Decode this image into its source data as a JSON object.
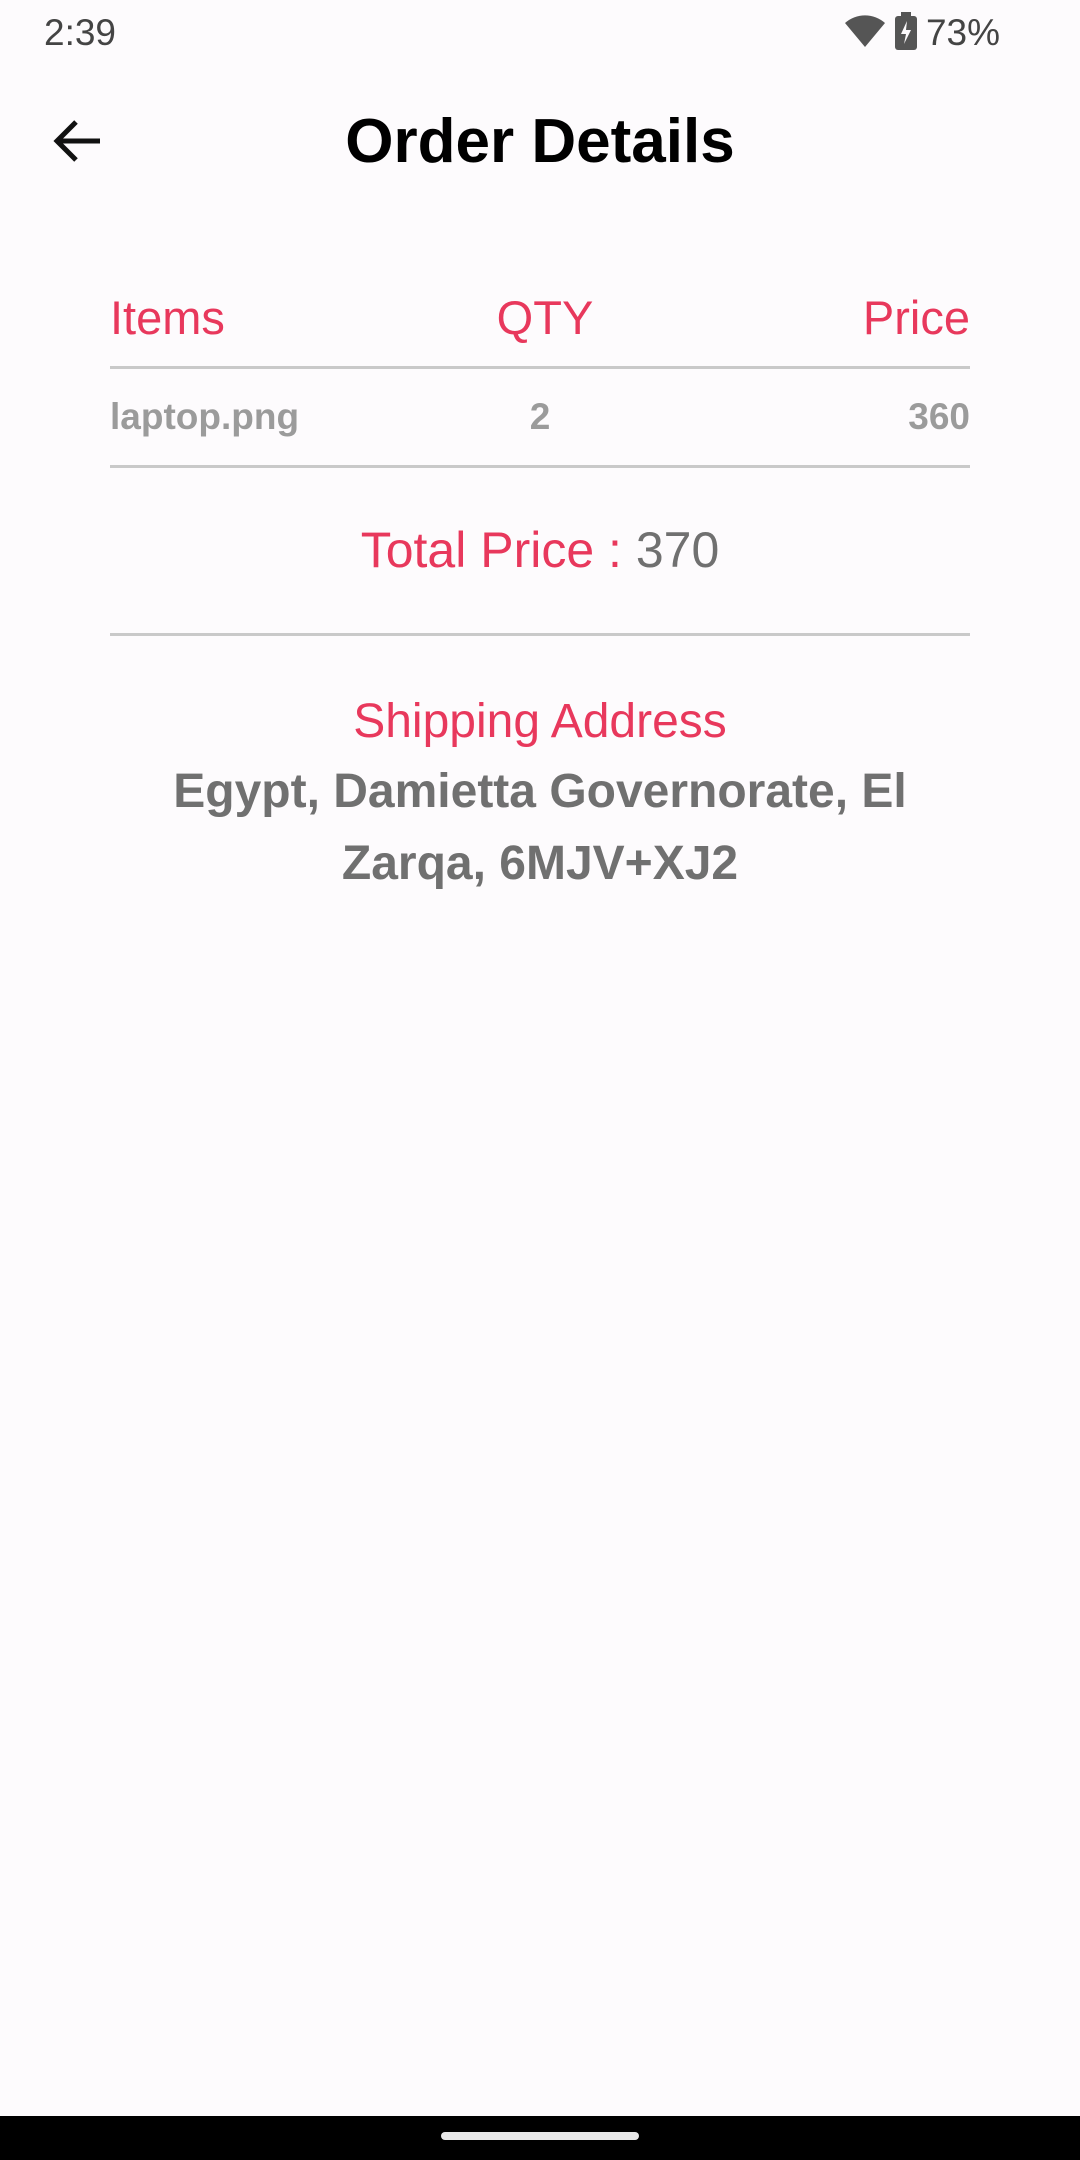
{
  "status_bar": {
    "time": "2:39",
    "battery_percent": "73%",
    "icons": [
      "wifi-icon",
      "battery-charging-icon"
    ]
  },
  "app_bar": {
    "title": "Order Details",
    "back_icon": "arrow-back-icon"
  },
  "table": {
    "headers": [
      "Items",
      "QTY",
      "Price"
    ],
    "rows": [
      {
        "item": "laptop.png",
        "qty": "2",
        "price": "360"
      }
    ]
  },
  "total": {
    "label": "Total Price : ",
    "value": "370"
  },
  "shipping": {
    "title": "Shipping Address",
    "address": "Egypt, Damietta Governorate, El Zarqa, 6MJV+XJ2"
  },
  "colors": {
    "accent": "#e8385c",
    "muted_text": "#707070",
    "light_text": "#9b9b9b",
    "divider": "#c9c9c9",
    "background": "#fdfbfd"
  }
}
